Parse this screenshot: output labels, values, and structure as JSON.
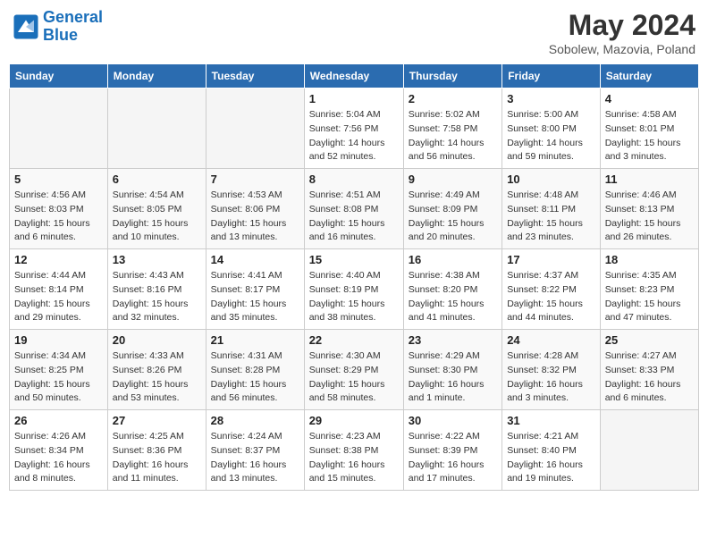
{
  "header": {
    "logo_line1": "General",
    "logo_line2": "Blue",
    "title": "May 2024",
    "subtitle": "Sobolew, Mazovia, Poland"
  },
  "weekdays": [
    "Sunday",
    "Monday",
    "Tuesday",
    "Wednesday",
    "Thursday",
    "Friday",
    "Saturday"
  ],
  "weeks": [
    [
      {
        "day": "",
        "info": ""
      },
      {
        "day": "",
        "info": ""
      },
      {
        "day": "",
        "info": ""
      },
      {
        "day": "1",
        "info": "Sunrise: 5:04 AM\nSunset: 7:56 PM\nDaylight: 14 hours\nand 52 minutes."
      },
      {
        "day": "2",
        "info": "Sunrise: 5:02 AM\nSunset: 7:58 PM\nDaylight: 14 hours\nand 56 minutes."
      },
      {
        "day": "3",
        "info": "Sunrise: 5:00 AM\nSunset: 8:00 PM\nDaylight: 14 hours\nand 59 minutes."
      },
      {
        "day": "4",
        "info": "Sunrise: 4:58 AM\nSunset: 8:01 PM\nDaylight: 15 hours\nand 3 minutes."
      }
    ],
    [
      {
        "day": "5",
        "info": "Sunrise: 4:56 AM\nSunset: 8:03 PM\nDaylight: 15 hours\nand 6 minutes."
      },
      {
        "day": "6",
        "info": "Sunrise: 4:54 AM\nSunset: 8:05 PM\nDaylight: 15 hours\nand 10 minutes."
      },
      {
        "day": "7",
        "info": "Sunrise: 4:53 AM\nSunset: 8:06 PM\nDaylight: 15 hours\nand 13 minutes."
      },
      {
        "day": "8",
        "info": "Sunrise: 4:51 AM\nSunset: 8:08 PM\nDaylight: 15 hours\nand 16 minutes."
      },
      {
        "day": "9",
        "info": "Sunrise: 4:49 AM\nSunset: 8:09 PM\nDaylight: 15 hours\nand 20 minutes."
      },
      {
        "day": "10",
        "info": "Sunrise: 4:48 AM\nSunset: 8:11 PM\nDaylight: 15 hours\nand 23 minutes."
      },
      {
        "day": "11",
        "info": "Sunrise: 4:46 AM\nSunset: 8:13 PM\nDaylight: 15 hours\nand 26 minutes."
      }
    ],
    [
      {
        "day": "12",
        "info": "Sunrise: 4:44 AM\nSunset: 8:14 PM\nDaylight: 15 hours\nand 29 minutes."
      },
      {
        "day": "13",
        "info": "Sunrise: 4:43 AM\nSunset: 8:16 PM\nDaylight: 15 hours\nand 32 minutes."
      },
      {
        "day": "14",
        "info": "Sunrise: 4:41 AM\nSunset: 8:17 PM\nDaylight: 15 hours\nand 35 minutes."
      },
      {
        "day": "15",
        "info": "Sunrise: 4:40 AM\nSunset: 8:19 PM\nDaylight: 15 hours\nand 38 minutes."
      },
      {
        "day": "16",
        "info": "Sunrise: 4:38 AM\nSunset: 8:20 PM\nDaylight: 15 hours\nand 41 minutes."
      },
      {
        "day": "17",
        "info": "Sunrise: 4:37 AM\nSunset: 8:22 PM\nDaylight: 15 hours\nand 44 minutes."
      },
      {
        "day": "18",
        "info": "Sunrise: 4:35 AM\nSunset: 8:23 PM\nDaylight: 15 hours\nand 47 minutes."
      }
    ],
    [
      {
        "day": "19",
        "info": "Sunrise: 4:34 AM\nSunset: 8:25 PM\nDaylight: 15 hours\nand 50 minutes."
      },
      {
        "day": "20",
        "info": "Sunrise: 4:33 AM\nSunset: 8:26 PM\nDaylight: 15 hours\nand 53 minutes."
      },
      {
        "day": "21",
        "info": "Sunrise: 4:31 AM\nSunset: 8:28 PM\nDaylight: 15 hours\nand 56 minutes."
      },
      {
        "day": "22",
        "info": "Sunrise: 4:30 AM\nSunset: 8:29 PM\nDaylight: 15 hours\nand 58 minutes."
      },
      {
        "day": "23",
        "info": "Sunrise: 4:29 AM\nSunset: 8:30 PM\nDaylight: 16 hours\nand 1 minute."
      },
      {
        "day": "24",
        "info": "Sunrise: 4:28 AM\nSunset: 8:32 PM\nDaylight: 16 hours\nand 3 minutes."
      },
      {
        "day": "25",
        "info": "Sunrise: 4:27 AM\nSunset: 8:33 PM\nDaylight: 16 hours\nand 6 minutes."
      }
    ],
    [
      {
        "day": "26",
        "info": "Sunrise: 4:26 AM\nSunset: 8:34 PM\nDaylight: 16 hours\nand 8 minutes."
      },
      {
        "day": "27",
        "info": "Sunrise: 4:25 AM\nSunset: 8:36 PM\nDaylight: 16 hours\nand 11 minutes."
      },
      {
        "day": "28",
        "info": "Sunrise: 4:24 AM\nSunset: 8:37 PM\nDaylight: 16 hours\nand 13 minutes."
      },
      {
        "day": "29",
        "info": "Sunrise: 4:23 AM\nSunset: 8:38 PM\nDaylight: 16 hours\nand 15 minutes."
      },
      {
        "day": "30",
        "info": "Sunrise: 4:22 AM\nSunset: 8:39 PM\nDaylight: 16 hours\nand 17 minutes."
      },
      {
        "day": "31",
        "info": "Sunrise: 4:21 AM\nSunset: 8:40 PM\nDaylight: 16 hours\nand 19 minutes."
      },
      {
        "day": "",
        "info": ""
      }
    ]
  ]
}
